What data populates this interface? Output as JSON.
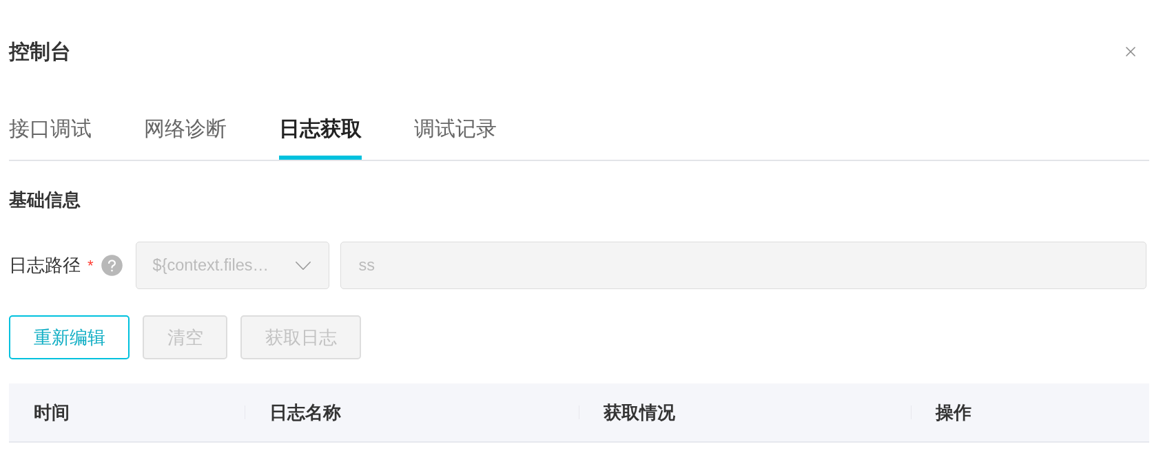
{
  "dialog": {
    "title": "控制台"
  },
  "tabs": [
    {
      "label": "接口调试",
      "selected": false
    },
    {
      "label": "网络诊断",
      "selected": false
    },
    {
      "label": "日志获取",
      "selected": true
    },
    {
      "label": "调试记录",
      "selected": false
    }
  ],
  "section": {
    "title": "基础信息"
  },
  "form": {
    "log_path": {
      "label": "日志路径",
      "required_mark": "*",
      "select": {
        "value": "${context.files…",
        "disabled": true
      },
      "input": {
        "value": "ss",
        "disabled": true
      }
    }
  },
  "buttons": [
    {
      "label": "重新编辑",
      "disabled": false
    },
    {
      "label": "清空",
      "disabled": true
    },
    {
      "label": "获取日志",
      "disabled": true
    }
  ],
  "table": {
    "columns": [
      "时间",
      "日志名称",
      "获取情况",
      "操作"
    ]
  }
}
